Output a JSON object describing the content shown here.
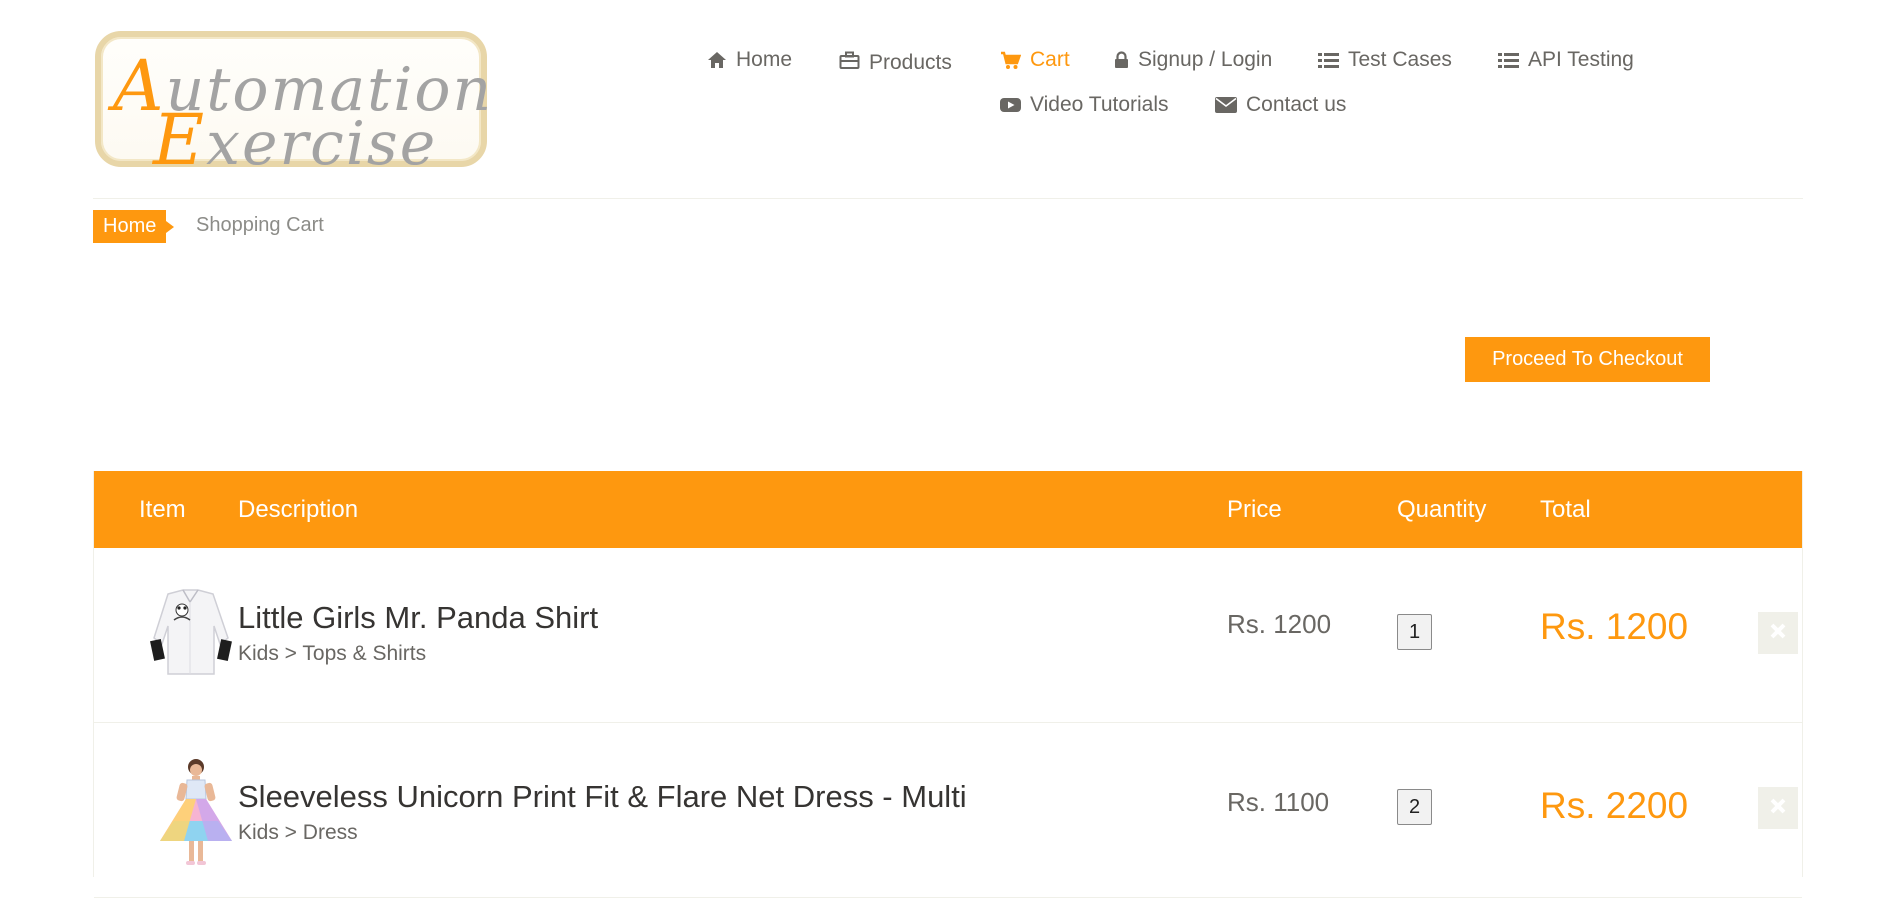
{
  "logo": {
    "line1_cap": "A",
    "line1_rest": "utomation",
    "line2_cap": "E",
    "line2_rest": "xercise"
  },
  "nav": {
    "items": [
      {
        "label": "Home",
        "icon": "home-icon"
      },
      {
        "label": "Products",
        "icon": "briefcase-icon"
      },
      {
        "label": "Cart",
        "icon": "shopping-cart-icon",
        "active": true
      },
      {
        "label": "Signup / Login",
        "icon": "lock-icon"
      },
      {
        "label": "Test Cases",
        "icon": "list-icon"
      },
      {
        "label": "API Testing",
        "icon": "list-icon"
      },
      {
        "label": "Video Tutorials",
        "icon": "youtube-play-icon"
      },
      {
        "label": "Contact us",
        "icon": "envelope-icon"
      }
    ]
  },
  "breadcrumb": {
    "home": "Home",
    "current": "Shopping Cart"
  },
  "checkout": {
    "label": "Proceed To Checkout"
  },
  "table": {
    "headers": {
      "item": "Item",
      "description": "Description",
      "price": "Price",
      "quantity": "Quantity",
      "total": "Total"
    },
    "rows": [
      {
        "name": "Little Girls Mr. Panda Shirt",
        "category": "Kids > Tops & Shirts",
        "price": "Rs. 1200",
        "quantity": "1",
        "total": "Rs. 1200",
        "delete_icon": "close-icon"
      },
      {
        "name": "Sleeveless Unicorn Print Fit & Flare Net Dress - Multi",
        "category": "Kids > Dress",
        "price": "Rs. 1100",
        "quantity": "2",
        "total": "Rs. 2200",
        "delete_icon": "close-icon"
      }
    ]
  },
  "colors": {
    "accent": "#fe980f",
    "text": "#696763",
    "heading": "#363432",
    "border": "#f0f0e9"
  }
}
